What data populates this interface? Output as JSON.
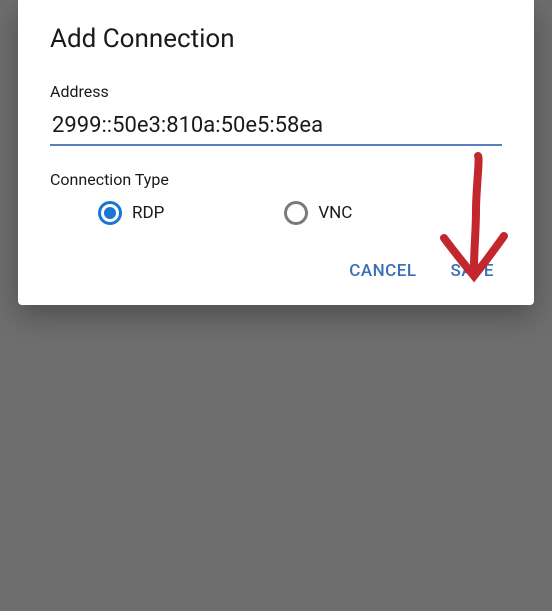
{
  "dialog": {
    "title": "Add Connection",
    "address": {
      "label": "Address",
      "value": "2999::50e3:810a:50e5:58ea"
    },
    "connectionType": {
      "label": "Connection Type",
      "options": [
        {
          "label": "RDP",
          "selected": true
        },
        {
          "label": "VNC",
          "selected": false
        }
      ]
    },
    "actions": {
      "cancel": "CANCEL",
      "save": "SAVE"
    }
  },
  "annotation": {
    "type": "hand-drawn-arrow",
    "color": "#c1272d",
    "points_to": "save-button"
  }
}
